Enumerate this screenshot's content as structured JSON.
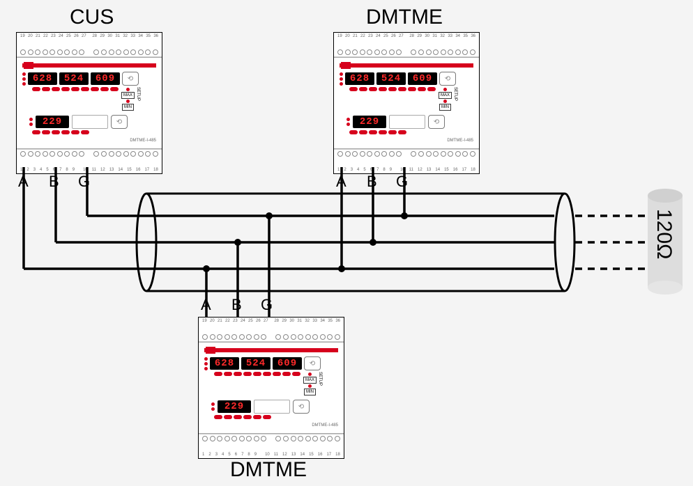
{
  "diagram": {
    "devices": [
      {
        "key": "dev1",
        "title": "CUS",
        "title_pos": "top",
        "display_top": [
          "628",
          "524",
          "609"
        ],
        "display_bottom": "229",
        "max_label": "MAX",
        "min_label": "MIN",
        "setup_label": "SETUP",
        "model": "DMTME-I-485",
        "terminals_top": [
          "19",
          "20",
          "21",
          "22",
          "23",
          "24",
          "25",
          "26",
          "27",
          "",
          "28",
          "29",
          "30",
          "31",
          "32",
          "33",
          "34",
          "35",
          "36"
        ],
        "terminals_bot_left": [
          "1",
          "2",
          "3",
          "4",
          "5",
          "6",
          "7",
          "8",
          "9"
        ],
        "terminals_bot_right": [
          "10",
          "11",
          "12",
          "13",
          "14",
          "15",
          "16",
          "17",
          "18"
        ],
        "wires": [
          "A",
          "B",
          "G"
        ],
        "wires_pos": "below"
      },
      {
        "key": "dev2",
        "title": "DMTME",
        "title_pos": "top",
        "display_top": [
          "628",
          "524",
          "609"
        ],
        "display_bottom": "229",
        "max_label": "MAX",
        "min_label": "MIN",
        "setup_label": "SETUP",
        "model": "DMTME-I-485",
        "terminals_top": [
          "19",
          "20",
          "21",
          "22",
          "23",
          "24",
          "25",
          "26",
          "27",
          "",
          "28",
          "29",
          "30",
          "31",
          "32",
          "33",
          "34",
          "35",
          "36"
        ],
        "terminals_bot_left": [
          "1",
          "2",
          "3",
          "4",
          "5",
          "6",
          "7",
          "8",
          "9"
        ],
        "terminals_bot_right": [
          "10",
          "11",
          "12",
          "13",
          "14",
          "15",
          "16",
          "17",
          "18"
        ],
        "wires": [
          "A",
          "B",
          "G"
        ],
        "wires_pos": "below"
      },
      {
        "key": "dev3",
        "title": "DMTME",
        "title_pos": "bottom",
        "display_top": [
          "628",
          "524",
          "609"
        ],
        "display_bottom": "229",
        "max_label": "MAX",
        "min_label": "MIN",
        "setup_label": "SETUP",
        "model": "DMTME-I-485",
        "terminals_top": [
          "19",
          "20",
          "21",
          "22",
          "23",
          "24",
          "25",
          "26",
          "27",
          "",
          "28",
          "29",
          "30",
          "31",
          "32",
          "33",
          "34",
          "35",
          "36"
        ],
        "terminals_bot_left": [
          "1",
          "2",
          "3",
          "4",
          "5",
          "6",
          "7",
          "8",
          "9"
        ],
        "terminals_bot_right": [
          "10",
          "11",
          "12",
          "13",
          "14",
          "15",
          "16",
          "17",
          "18"
        ],
        "wires": [
          "A",
          "B",
          "G"
        ],
        "wires_pos": "above"
      }
    ],
    "bus": {
      "terminator_label": "120Ω"
    }
  }
}
